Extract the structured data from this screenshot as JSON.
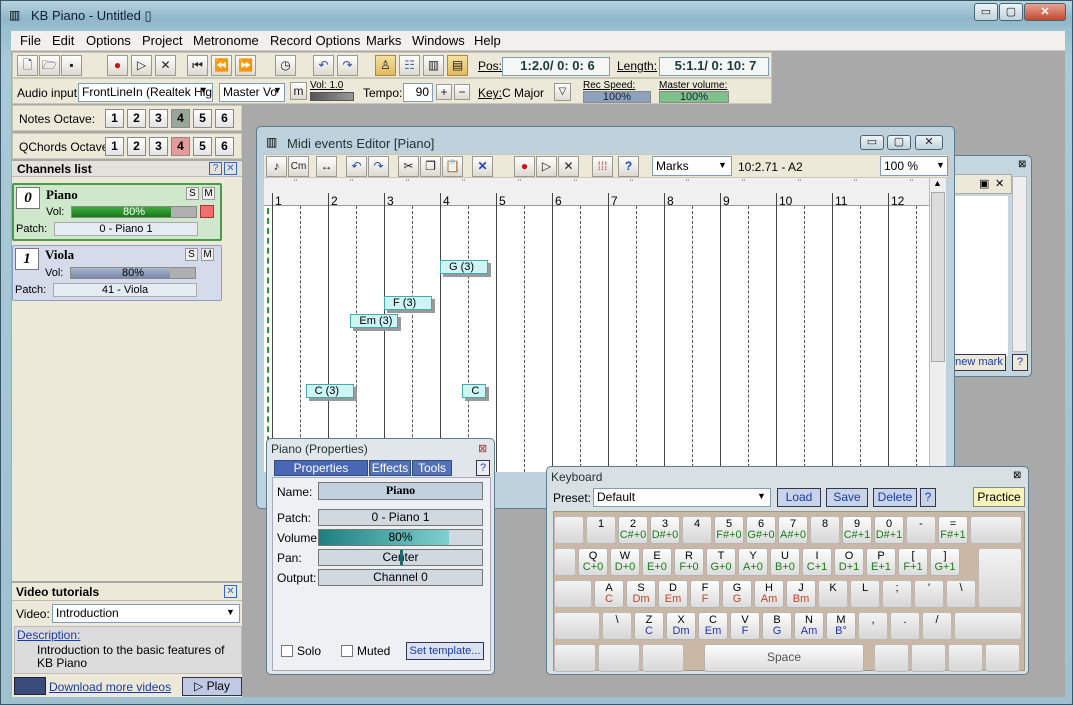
{
  "window": {
    "title": "KB Piano - Untitled ▯"
  },
  "menu": [
    "File",
    "Edit",
    "Options",
    "Project",
    "Metronome",
    "Record Options",
    "Marks",
    "Windows",
    "Help"
  ],
  "position": {
    "pos_label": "Pos:",
    "pos_value": "1:2.0/ 0: 0: 6",
    "length_label": "Length:",
    "length_value": "5:1.1/ 0: 10: 7"
  },
  "audio": {
    "label": "Audio input:",
    "device": "FrontLineIn (Realtek Hig",
    "master": "Master Vo",
    "m_button": "m",
    "vol_label": "Vol: 1.0",
    "tempo_label": "Tempo:",
    "tempo_value": "90",
    "key_label": "Key:",
    "key_value": "C Major",
    "rec_speed_label": "Rec Speed:",
    "rec_speed_value": "100%",
    "master_volume_label": "Master volume:",
    "master_volume_value": "100%"
  },
  "octaves": {
    "notes_label": "Notes Octave:",
    "qchords_label": "QChords Octave:",
    "numbers": [
      "1",
      "2",
      "3",
      "4",
      "5",
      "6"
    ],
    "notes_selected": 3,
    "qchords_selected": 3
  },
  "channels": {
    "title": "Channels list",
    "items": [
      {
        "num": "0",
        "name": "Piano",
        "vol_label": "Vol:",
        "vol": "80%",
        "vol_level": 0.8,
        "patch_label": "Patch:",
        "patch": "0 - Piano 1",
        "color": "#1e8a1e"
      },
      {
        "num": "1",
        "name": "Viola",
        "vol_label": "Vol:",
        "vol": "80%",
        "vol_level": 0.8,
        "patch_label": "Patch:",
        "patch": "41 - Viola",
        "color": "#7788aa"
      }
    ],
    "s": "S",
    "m": "M"
  },
  "video": {
    "title": "Video tutorials",
    "video_label": "Video:",
    "video_value": "Introduction",
    "desc_label": "Description:",
    "desc": "Introduction to the basic features of KB Piano",
    "download": "Download more videos",
    "play": "▷ Play"
  },
  "midi_editor": {
    "title": "Midi events Editor [Piano]",
    "cm": "Cm",
    "marks": "Marks",
    "pos": "10:2.71 - A2",
    "zoom": "100 %",
    "measures": [
      "1",
      "2",
      "3",
      "4",
      "5",
      "6",
      "7",
      "8",
      "9",
      "10",
      "11",
      "12"
    ],
    "notes": [
      {
        "label": "G (3)",
        "measure": 4.0,
        "row": 0
      },
      {
        "label": "F (3)",
        "measure": 3.0,
        "row": 1
      },
      {
        "label": "Em (3)",
        "measure": 2.4,
        "row": 2
      },
      {
        "label": "C (3)",
        "measure": 1.6,
        "row": 3
      },
      {
        "label": "C",
        "measure": 4.4,
        "row": 3
      }
    ]
  },
  "marks_win": {
    "new_mark": "new mark",
    "help": "?"
  },
  "properties": {
    "title": "Piano (Properties)",
    "tabs": [
      "Properties",
      "Effects",
      "Tools"
    ],
    "name_label": "Name:",
    "name": "Piano",
    "patch_label": "Patch:",
    "patch": "0 - Piano 1",
    "volume_label": "Volume:",
    "volume": "80%",
    "volume_level": 0.8,
    "pan_label": "Pan:",
    "pan": "Center",
    "output_label": "Output:",
    "output": "Channel 0",
    "solo": "Solo",
    "muted": "Muted",
    "set_template": "Set template..."
  },
  "keyboard": {
    "title": "Keyboard",
    "preset_label": "Preset:",
    "preset": "Default",
    "load": "Load",
    "save": "Save",
    "delete": "Delete",
    "help": "?",
    "practice": "Practice",
    "row1": [
      {
        "k": ""
      },
      {
        "k": "1"
      },
      {
        "k": "2",
        "n": "C#+0"
      },
      {
        "k": "3",
        "n": "D#+0"
      },
      {
        "k": "4"
      },
      {
        "k": "5",
        "n": "F#+0"
      },
      {
        "k": "6",
        "n": "G#+0"
      },
      {
        "k": "7",
        "n": "A#+0"
      },
      {
        "k": "8"
      },
      {
        "k": "9",
        "n": "C#+1"
      },
      {
        "k": "0",
        "n": "D#+1"
      },
      {
        "k": "-"
      },
      {
        "k": "=",
        "n": "F#+1"
      }
    ],
    "row2": [
      {
        "k": "Q",
        "n": "C+0"
      },
      {
        "k": "W",
        "n": "D+0"
      },
      {
        "k": "E",
        "n": "E+0"
      },
      {
        "k": "R",
        "n": "F+0"
      },
      {
        "k": "T",
        "n": "G+0"
      },
      {
        "k": "Y",
        "n": "A+0"
      },
      {
        "k": "U",
        "n": "B+0"
      },
      {
        "k": "I",
        "n": "C+1"
      },
      {
        "k": "O",
        "n": "D+1"
      },
      {
        "k": "P",
        "n": "E+1"
      },
      {
        "k": "[",
        "n": "F+1"
      },
      {
        "k": "]",
        "n": "G+1"
      }
    ],
    "row3": [
      {
        "k": "A",
        "n": "C"
      },
      {
        "k": "S",
        "n": "Dm"
      },
      {
        "k": "D",
        "n": "Em"
      },
      {
        "k": "F",
        "n": "F"
      },
      {
        "k": "G",
        "n": "G"
      },
      {
        "k": "H",
        "n": "Am"
      },
      {
        "k": "J",
        "n": "Bm"
      },
      {
        "k": "K"
      },
      {
        "k": "L"
      },
      {
        "k": ";"
      },
      {
        "k": "'"
      },
      {
        "k": "\\"
      }
    ],
    "row4": [
      {
        "k": "\\"
      },
      {
        "k": "Z",
        "n": "C"
      },
      {
        "k": "X",
        "n": "Dm"
      },
      {
        "k": "C",
        "n": "Em"
      },
      {
        "k": "V",
        "n": "F"
      },
      {
        "k": "B",
        "n": "G"
      },
      {
        "k": "N",
        "n": "Am"
      },
      {
        "k": "M",
        "n": "B°"
      },
      {
        "k": ","
      },
      {
        "k": "."
      },
      {
        "k": "/"
      }
    ],
    "space": "Space"
  }
}
